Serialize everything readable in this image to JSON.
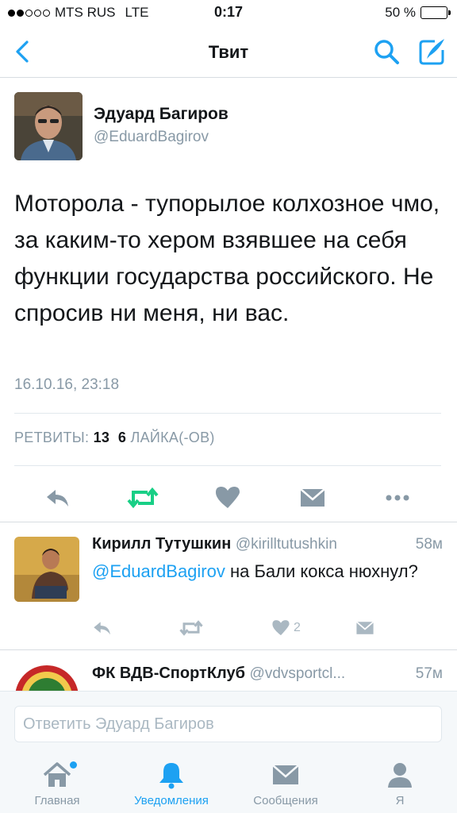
{
  "status": {
    "carrier": "MTS RUS",
    "network": "LTE",
    "time": "0:17",
    "battery": "50 %",
    "battery_level": 0.5,
    "signal_bars": 2
  },
  "nav": {
    "title": "Твит"
  },
  "tweet": {
    "author_name": "Эдуард Багиров",
    "author_handle": "@EduardBagirov",
    "text": "Моторола - тупорылое колхозное чмо, за каким-то хером взявшее на себя функции государства российского. Не спросив ни меня, ни вас.",
    "date": "16.10.16, 23:18",
    "retweets_label": "РЕТВИТЫ:",
    "retweets_count": "13",
    "likes_count": "6",
    "likes_label": "ЛАЙКА(-ОВ)"
  },
  "replies": [
    {
      "name": "Кирилл Тутушкин",
      "handle": "@kirilltutushkin",
      "time": "58м",
      "mention": "@EduardBagirov",
      "text": " на Бали кокса нюхнул?",
      "likes": "2"
    },
    {
      "name": "ФК  ВДВ-СпортКлуб",
      "handle": "@vdvsportcl...",
      "time": "57м"
    }
  ],
  "composer": {
    "placeholder": "Ответить Эдуард Багиров"
  },
  "tabs": [
    {
      "label": "Главная",
      "icon": "home-icon",
      "active": false
    },
    {
      "label": "Уведомления",
      "icon": "bell-icon",
      "active": true
    },
    {
      "label": "Сообщения",
      "icon": "envelope-icon",
      "active": false
    },
    {
      "label": "Я",
      "icon": "person-icon",
      "active": false
    }
  ],
  "colors": {
    "accent": "#1da1f2",
    "retweet_green": "#19cf86",
    "muted": "#8899a6"
  }
}
